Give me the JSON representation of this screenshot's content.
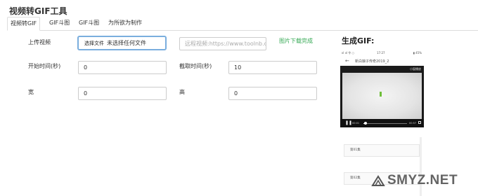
{
  "app": {
    "title": "视频转GIF工具"
  },
  "tabs": [
    {
      "label": "视频转GIF",
      "active": true
    },
    {
      "label": "GIF斗图",
      "active": false
    },
    {
      "label": "GIF斗图",
      "active": false
    },
    {
      "label": "为所欲为制作",
      "active": false
    }
  ],
  "form": {
    "upload_label": "上传视频",
    "file_button": "选择文件",
    "file_status": "未选择任何文件",
    "remote_placeholder": "远程视频:https://www.toolnb.c",
    "download_status": "图片下载完成",
    "start_label": "开始时间(秒)",
    "start_value": "0",
    "duration_label": "截取时间(秒)",
    "duration_value": "10",
    "width_label": "宽",
    "width_value": "0",
    "height_label": "高",
    "height_value": "0"
  },
  "preview": {
    "title": "生成GIF:",
    "status_left": "ııl ııl 令 ○",
    "status_time": "17:27",
    "status_right": "▮ 45%",
    "nav_back": "←",
    "nav_title": "新白娘子传奇2019_2",
    "video_topright": "小窗播放",
    "time_current": "00:01",
    "time_total": "00:57",
    "progress_fraction": 0.05,
    "playlist_title": "播放剧集",
    "episodes": [
      "第01集",
      "第02集"
    ]
  },
  "watermark": {
    "text": "SMYZ.NET"
  },
  "colors": {
    "accent_border": "#7aaede",
    "success": "#34a853",
    "video_bar": "#111111"
  }
}
